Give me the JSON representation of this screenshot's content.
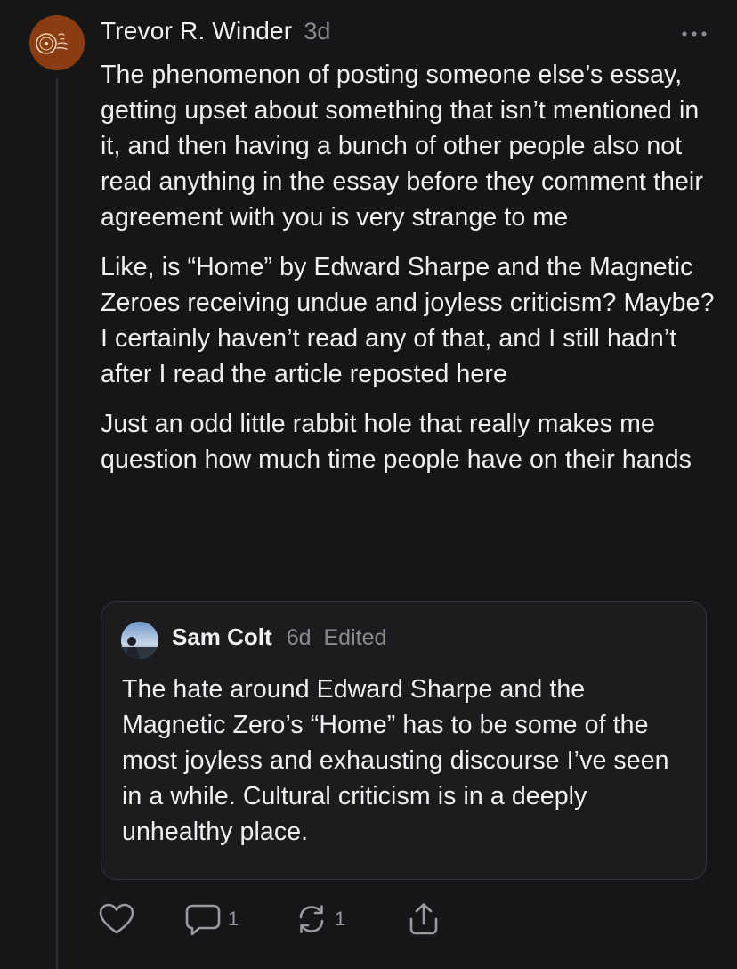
{
  "post": {
    "author": "Trevor R. Winder",
    "time": "3d",
    "avatar_icon": "record-logo-icon",
    "more_icon": "ellipsis-icon",
    "paragraphs": [
      "The phenomenon of posting someone else’s essay, getting upset about something that isn’t mentioned in it, and then having a bunch of other people also not read anything in the essay before they comment their agreement with you is very strange to me",
      "Like, is “Home” by Edward Sharpe and the Magnetic Zeroes receiving undue and joyless criticism? Maybe? I certainly haven’t read any of that, and I still hadn’t after I read the article reposted here",
      "Just an odd little rabbit hole that really makes me question how much time people have on their hands"
    ]
  },
  "quote": {
    "author": "Sam Colt",
    "time": "6d",
    "edited": "Edited",
    "text": "The hate around Edward Sharpe and the Magnetic Zero’s “Home” has to be some of the most joyless and exhausting discourse I’ve seen in a while. Cultural criticism is in a deeply unhealthy place."
  },
  "actions": {
    "like_icon": "heart-icon",
    "reply_icon": "comment-icon",
    "reply_count": "1",
    "restack_icon": "restack-icon",
    "restack_count": "1",
    "share_icon": "share-icon"
  },
  "colors": {
    "background": "#161618",
    "text": "#f0f0f2",
    "muted": "#8a8a90",
    "avatar": "#8a3d12",
    "card_border": "#34343a"
  }
}
